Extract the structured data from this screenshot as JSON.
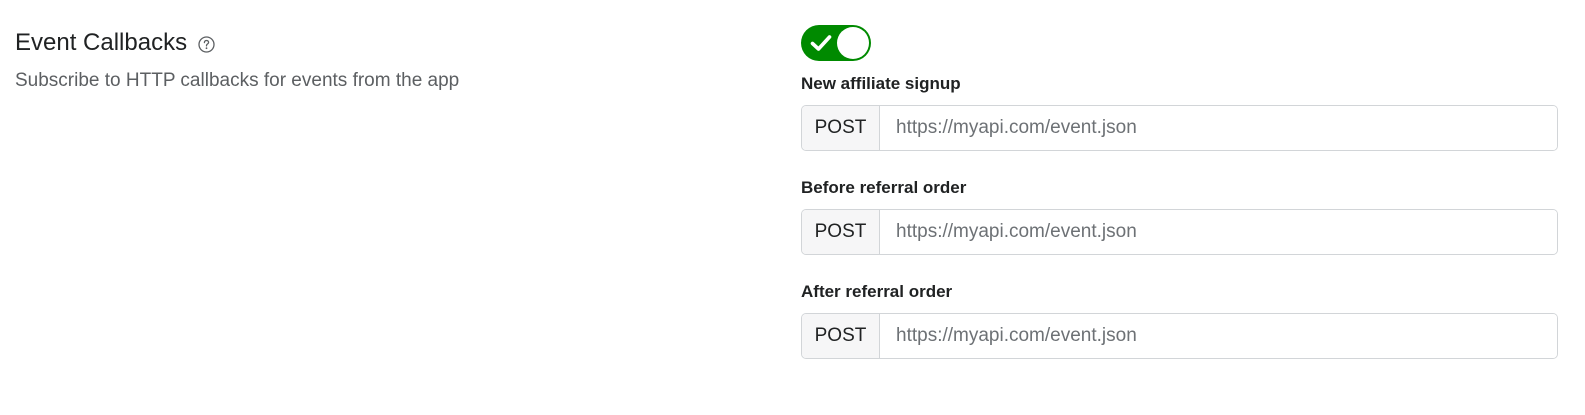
{
  "section": {
    "title": "Event Callbacks",
    "description": "Subscribe to HTTP callbacks for events from the app",
    "help_icon": "question-circle-icon"
  },
  "toggle": {
    "enabled": true,
    "color": "#008a00",
    "icon": "checkmark-icon"
  },
  "callbacks": [
    {
      "label": "New affiliate signup",
      "method": "POST",
      "placeholder": "https://myapi.com/event.json",
      "value": ""
    },
    {
      "label": "Before referral order",
      "method": "POST",
      "placeholder": "https://myapi.com/event.json",
      "value": ""
    },
    {
      "label": "After referral order",
      "method": "POST",
      "placeholder": "https://myapi.com/event.json",
      "value": ""
    }
  ]
}
